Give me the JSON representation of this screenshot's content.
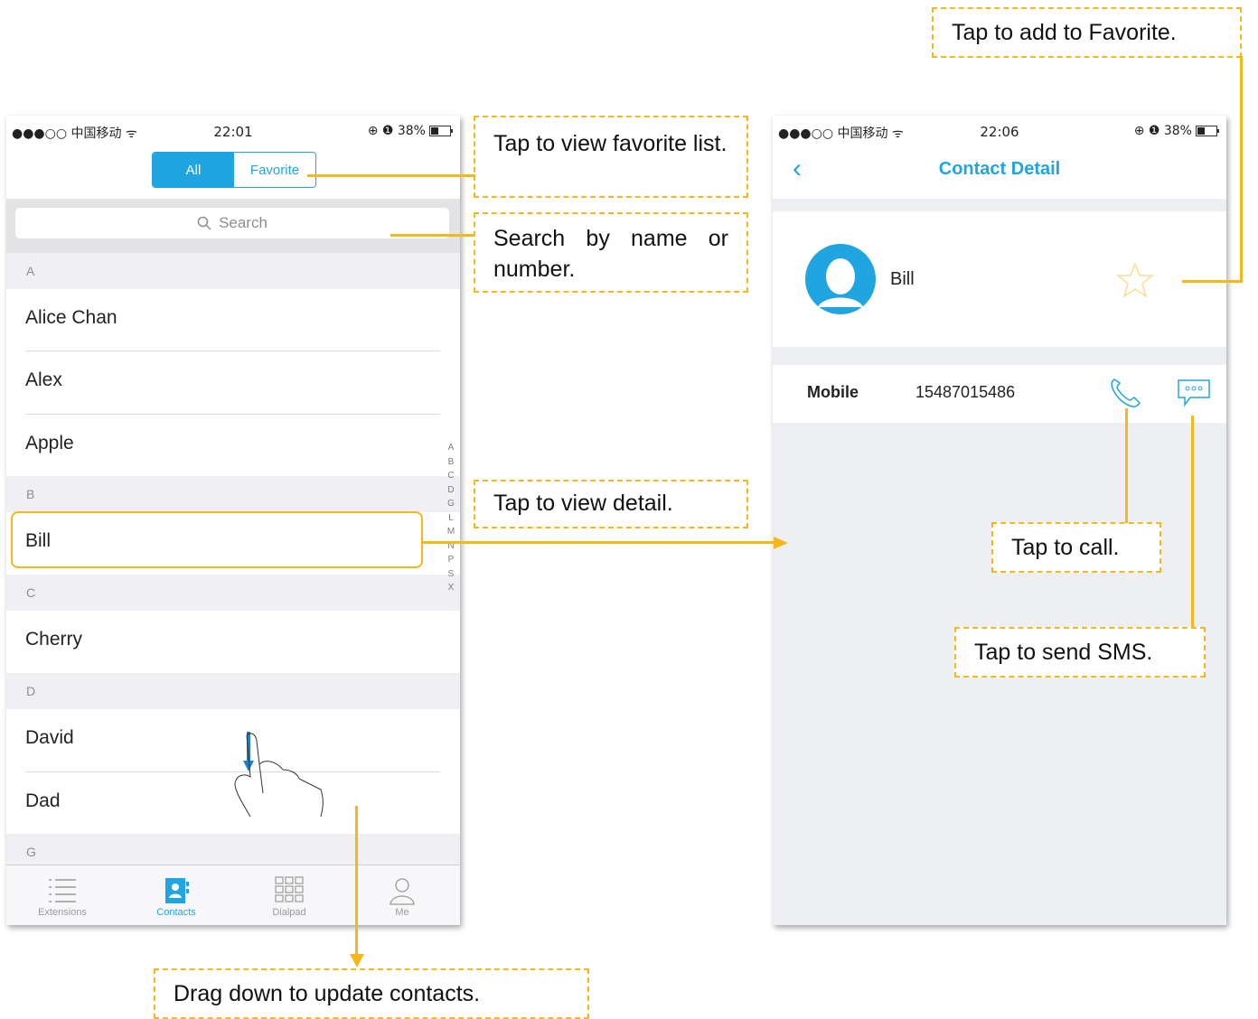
{
  "left_phone": {
    "status": {
      "carrier": "●●●○○ 中国移动 ᯤ",
      "time": "22:01",
      "battery_text": "⊕ ❶ 38%"
    },
    "segment": {
      "all": "All",
      "favorite": "Favorite"
    },
    "search": {
      "placeholder": "Search"
    },
    "sections": [
      {
        "letter": "A",
        "contacts": [
          "Alice Chan",
          "Alex",
          "Apple"
        ]
      },
      {
        "letter": "B",
        "contacts": [
          "Bill"
        ]
      },
      {
        "letter": "C",
        "contacts": [
          "Cherry"
        ]
      },
      {
        "letter": "D",
        "contacts": [
          "David",
          "Dad"
        ]
      },
      {
        "letter": "G",
        "contacts": []
      }
    ],
    "index_letters": [
      "A",
      "B",
      "C",
      "D",
      "G",
      "L",
      "M",
      "N",
      "P",
      "S",
      "X"
    ],
    "tabs": [
      {
        "label": "Extensions",
        "icon": "list-icon"
      },
      {
        "label": "Contacts",
        "icon": "contacts-book-icon"
      },
      {
        "label": "Dialpad",
        "icon": "dialpad-icon"
      },
      {
        "label": "Me",
        "icon": "person-icon"
      }
    ],
    "active_tab": "Contacts"
  },
  "right_phone": {
    "status": {
      "carrier": "●●●○○ 中国移动 ᯤ",
      "time": "22:06",
      "battery_text": "⊕ ❶ 38%"
    },
    "title": "Contact Detail",
    "contact_name": "Bill",
    "phone_label": "Mobile",
    "phone_number": "15487015486"
  },
  "callouts": {
    "favorite_list": "Tap to view favorite list.",
    "search": "Search by name or number.",
    "detail": "Tap to view detail.",
    "drag": "Drag down to update contacts.",
    "add_favorite": "Tap to add to Favorite.",
    "call": "Tap to call.",
    "sms": "Tap to send SMS."
  },
  "colors": {
    "accent": "#20a5e0",
    "callout": "#f5b81b"
  }
}
